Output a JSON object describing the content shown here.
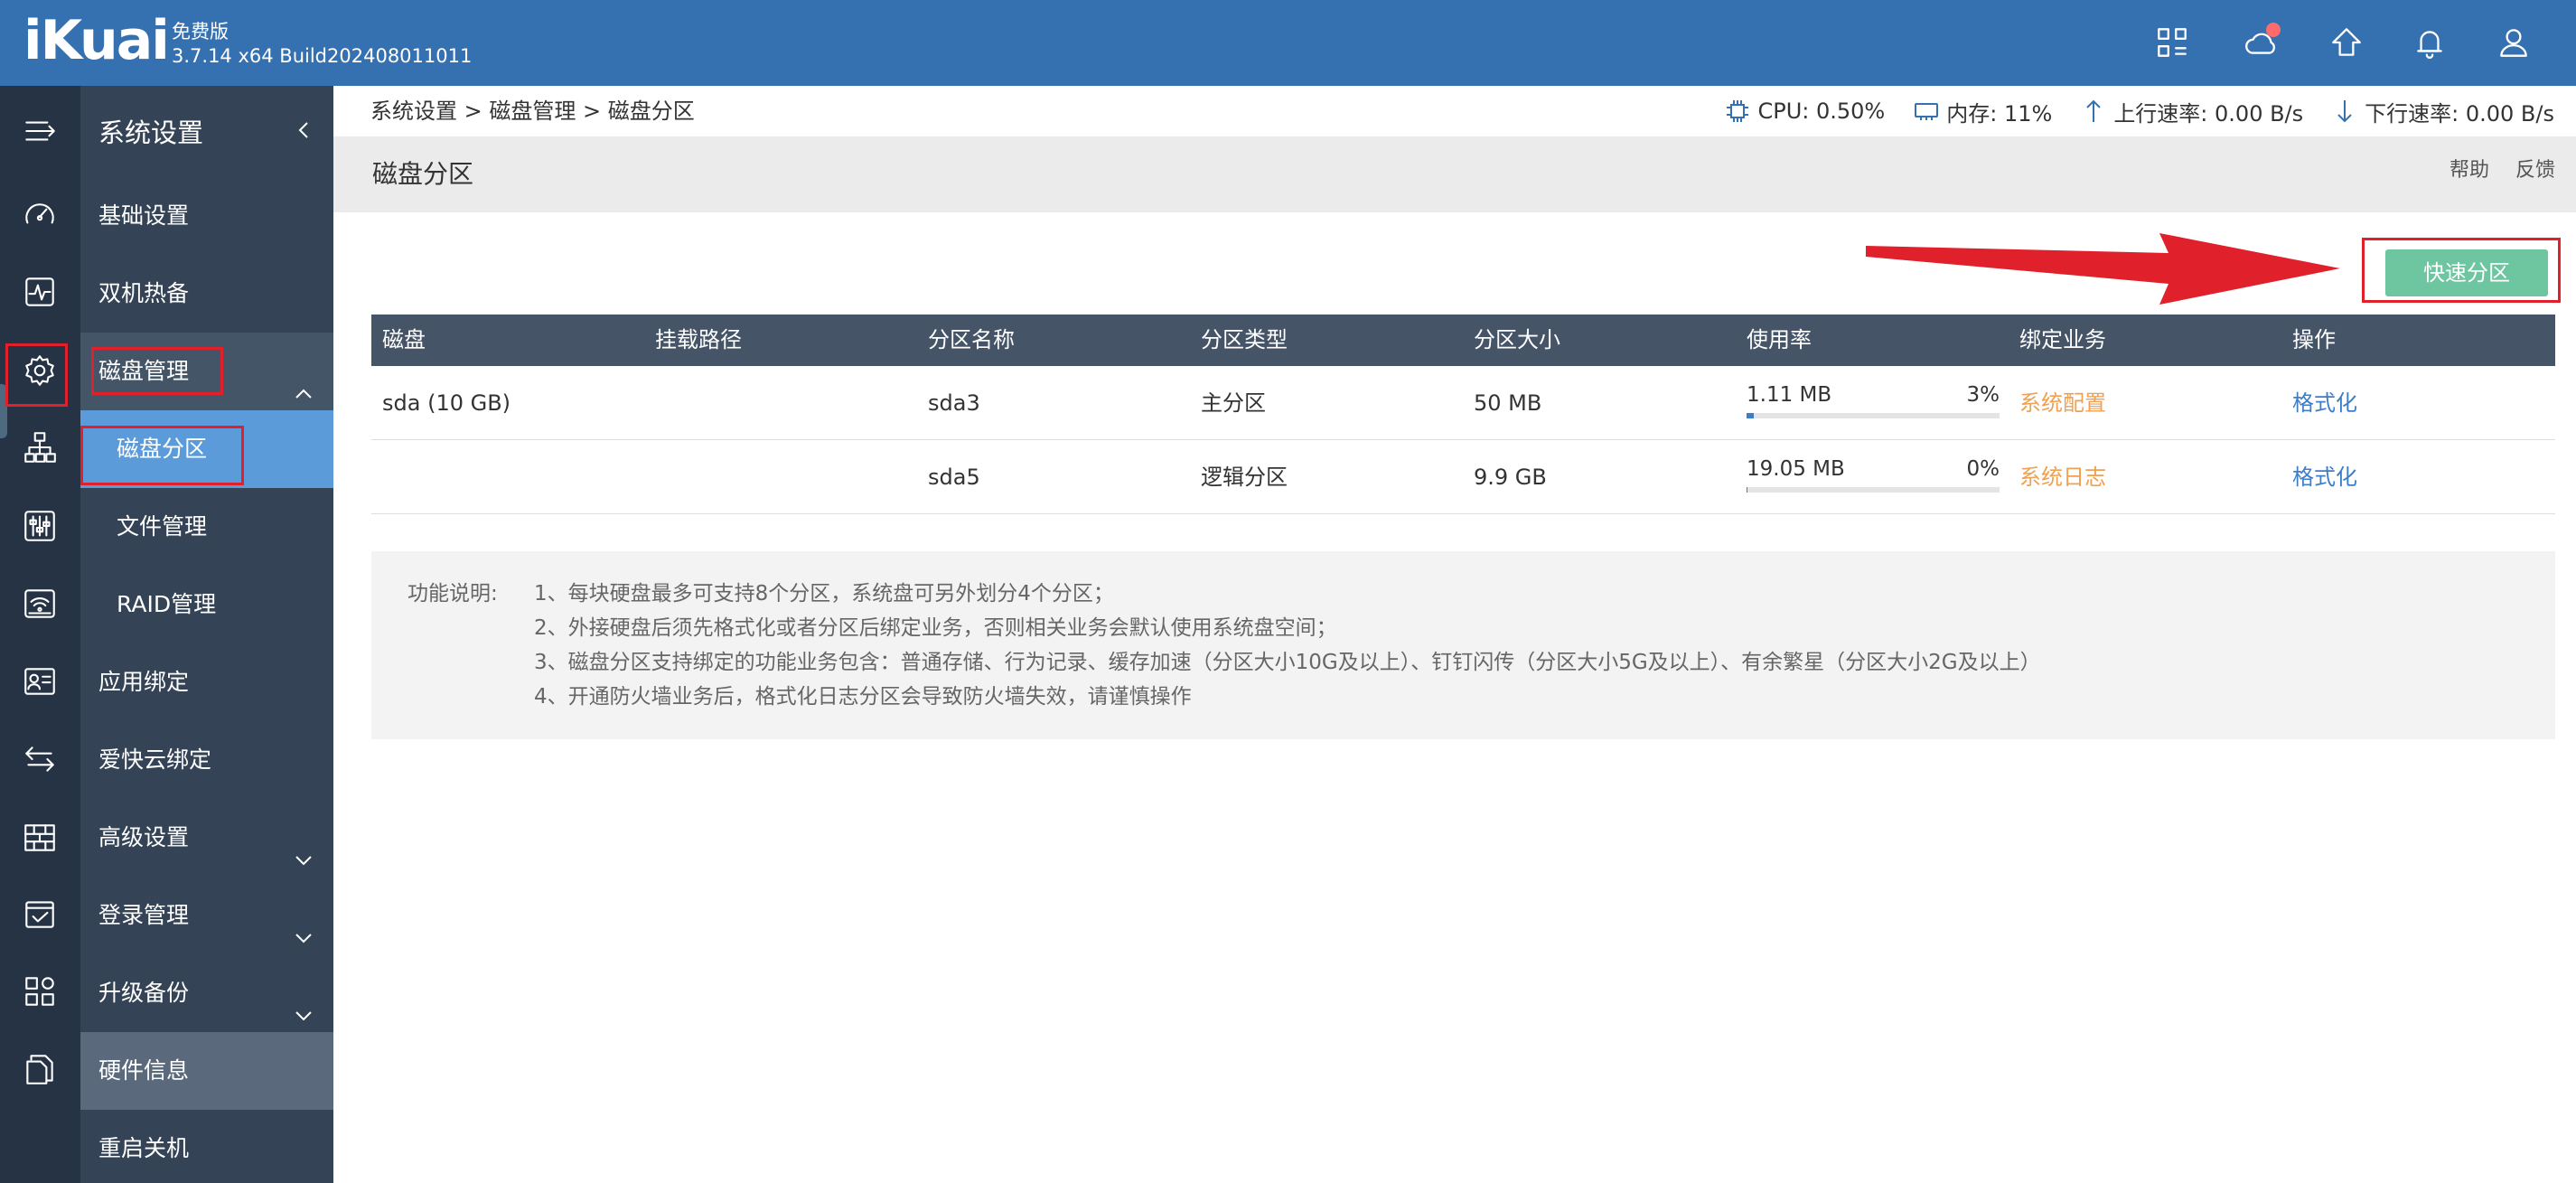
{
  "header": {
    "logo": "iKuai",
    "edition": "免费版",
    "version": "3.7.14 x64 Build202408011011"
  },
  "submenu": {
    "title": "系统设置",
    "items": [
      {
        "label": "基础设置"
      },
      {
        "label": "双机热备"
      },
      {
        "label": "磁盘管理"
      },
      {
        "label": "磁盘分区"
      },
      {
        "label": "文件管理"
      },
      {
        "label": "RAID管理"
      },
      {
        "label": "应用绑定"
      },
      {
        "label": "爱快云绑定"
      },
      {
        "label": "高级设置"
      },
      {
        "label": "登录管理"
      },
      {
        "label": "升级备份"
      },
      {
        "label": "硬件信息"
      },
      {
        "label": "重启关机"
      }
    ]
  },
  "breadcrumb": "系统设置 > 磁盘管理 > 磁盘分区",
  "stats": {
    "cpu": "CPU: 0.50%",
    "memory": "内存: 11%",
    "upload": "上行速率: 0.00 B/s",
    "download": "下行速率: 0.00 B/s"
  },
  "page": {
    "title": "磁盘分区",
    "help": "帮助",
    "feedback": "反馈",
    "quick_partition": "快速分区"
  },
  "table": {
    "columns": [
      "磁盘",
      "挂载路径",
      "分区名称",
      "分区类型",
      "分区大小",
      "使用率",
      "绑定业务",
      "操作"
    ],
    "rows": [
      {
        "disk": "sda (10 GB)",
        "mount": "",
        "name": "sda3",
        "type": "主分区",
        "size": "50 MB",
        "used": "1.11 MB",
        "percent": "3%",
        "percent_value": 3,
        "business": "系统配置",
        "action": "格式化"
      },
      {
        "disk": "",
        "mount": "",
        "name": "sda5",
        "type": "逻辑分区",
        "size": "9.9 GB",
        "used": "19.05 MB",
        "percent": "0%",
        "percent_value": 0,
        "business": "系统日志",
        "action": "格式化"
      }
    ]
  },
  "notes": {
    "label": "功能说明:",
    "lines": [
      "1、每块硬盘最多可支持8个分区，系统盘可另外划分4个分区；",
      "2、外接硬盘后须先格式化或者分区后绑定业务，否则相关业务会默认使用系统盘空间；",
      "3、磁盘分区支持绑定的功能业务包含：普通存储、行为记录、缓存加速（分区大小10G及以上）、钉钉闪传（分区大小5G及以上）、有余繁星（分区大小2G及以上）",
      "4、开通防火墙业务后，格式化日志分区会导致防火墙失效，请谨慎操作"
    ]
  },
  "colors": {
    "header_bg": "#3570b0",
    "rail_bg": "#263345",
    "submenu_bg": "#344356",
    "selected": "#5b9bd9",
    "button": "#6ec6a0",
    "highlight": "#e0202a",
    "business_text": "#f0a050",
    "link": "#3e7ec8"
  }
}
